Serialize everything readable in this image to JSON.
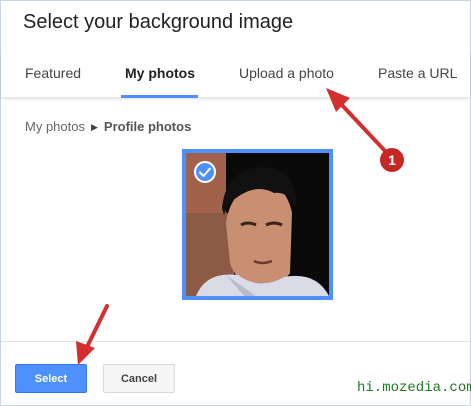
{
  "dialog": {
    "title": "Select your background image"
  },
  "tabs": [
    {
      "label": "Featured"
    },
    {
      "label": "My photos",
      "active": true
    },
    {
      "label": "Upload a photo"
    },
    {
      "label": "Paste a URL"
    }
  ],
  "breadcrumb": {
    "root": "My photos",
    "current": "Profile photos"
  },
  "photo": {
    "selected": true
  },
  "buttons": {
    "select_label": "Select",
    "cancel_label": "Cancel"
  },
  "annotation": {
    "badge_number": "1"
  },
  "watermark": "hi.mozedia.com",
  "colors": {
    "accent": "#4d90fe",
    "annotation": "#c62828",
    "watermark": "#1f7a1f"
  },
  "icons": [
    "check-icon",
    "chevron-right-icon",
    "arrow-icon"
  ]
}
